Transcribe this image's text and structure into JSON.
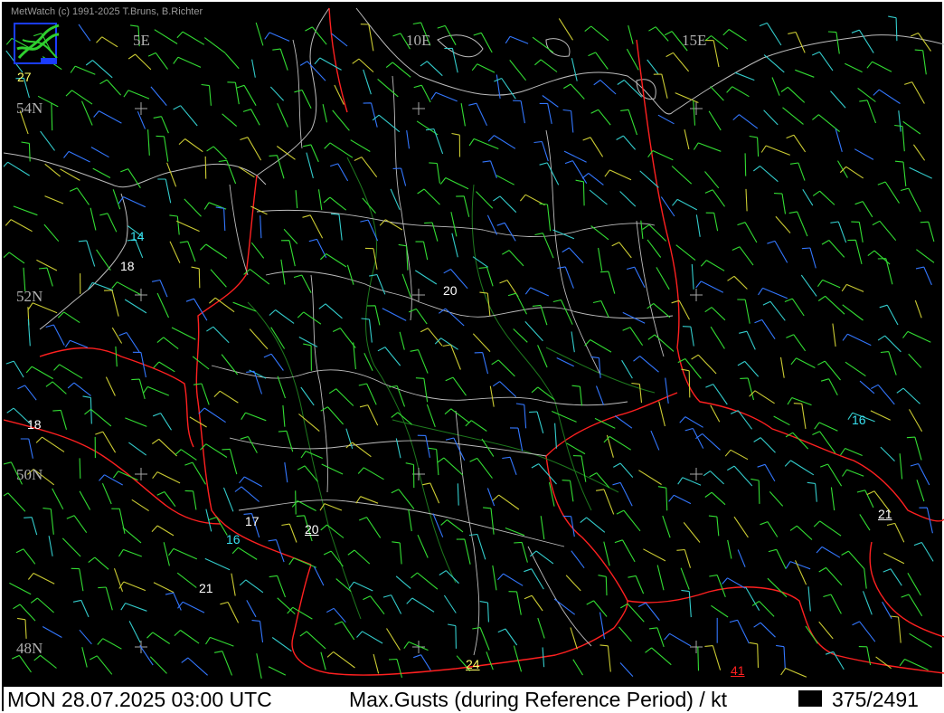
{
  "copyright": "MetWatch  (c) 1991-2025 T.Bruns, B.Richter",
  "grid_labels": {
    "lon_5e": "5E",
    "lon_10e": "10E",
    "lon_15e": "15E",
    "lat_54n": "54N",
    "lat_52n": "52N",
    "lat_50n": "50N",
    "lat_48n": "48N"
  },
  "stations": {
    "s27": "27",
    "s14": "14",
    "s18_coast": "18",
    "s20_north": "20",
    "s18_west": "18",
    "s16_east": "16",
    "s17": "17",
    "s20_south": "20",
    "s16_southwest": "16",
    "s21_east": "21",
    "s21_southwest": "21",
    "s24": "24",
    "s41": "41"
  },
  "status": {
    "datetime": "MON 28.07.2025 03:00 UTC",
    "parameter": "Max.Gusts (during Reference Period) / kt",
    "frame": "375/2491"
  },
  "colors": {
    "background": "#000000",
    "border_line": "#c8c8c8",
    "country_border": "#ff2020",
    "river": "#1e7a1e",
    "barb_green": "#33dd33",
    "barb_cyan": "#33cccc",
    "barb_blue": "#3377ff",
    "barb_yellow": "#cccc33"
  }
}
